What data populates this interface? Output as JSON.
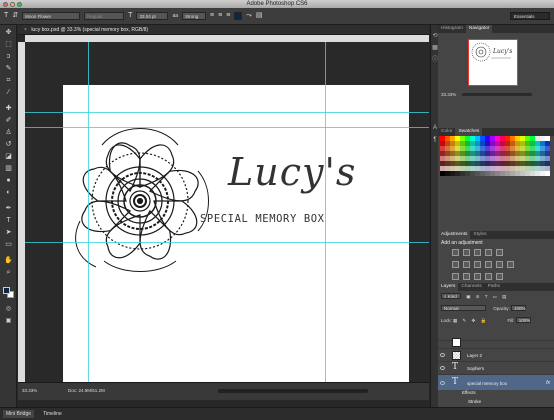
{
  "window": {
    "title": "Adobe Photoshop CS6",
    "traffic_colors": [
      "#fc605c",
      "#fdbc40",
      "#34c84a"
    ]
  },
  "options": {
    "tool_icon": "type-tool-icon",
    "orientation_icon": "text-orientation-icon",
    "font_family": "Moon Flower",
    "font_style": "Regular",
    "size_icon": "font-size-icon",
    "font_size": "33.04 pt",
    "aa_icon": "antialias-icon",
    "antialias": "Strong",
    "workspace": "Essentials"
  },
  "document": {
    "tab_label": "lucy box.psd @ 33.3% (special  memory  box, RGB/8)",
    "art_title": "Lucy's",
    "art_subtitle": "SPECIAL MEMORY BOX"
  },
  "status": {
    "zoom": "33.33%",
    "doc": "Doc: 24.9M/61.2M"
  },
  "bottom_tabs": [
    "Mini Bridge",
    "Timeline"
  ],
  "panels": {
    "navigator": {
      "tabs": [
        "Histogram",
        "Navigator"
      ],
      "zoom": "33.33%"
    },
    "swatches": {
      "tabs": [
        "Color",
        "Swatches"
      ]
    },
    "adjustments": {
      "tabs": [
        "Adjustments",
        "Styles"
      ],
      "title": "Add an adjustment"
    },
    "layers": {
      "tabs": [
        "Layers",
        "Channels",
        "Paths"
      ],
      "filter": "Kind",
      "blend_mode": "Normal",
      "opacity_label": "Opacity:",
      "opacity": "100%",
      "lock_label": "Lock:",
      "fill_label": "Fill:",
      "fill": "100%",
      "rows": [
        {
          "name": "Layer 2",
          "kind": "pixel"
        },
        {
          "name": "Sophie's",
          "kind": "text"
        },
        {
          "name": "special  memory  box",
          "kind": "text",
          "selected": true
        },
        {
          "name": "Effects",
          "kind": "sub"
        },
        {
          "name": "Stroke",
          "kind": "sub"
        }
      ]
    }
  },
  "tools": [
    "move-tool-icon",
    "marquee-tool-icon",
    "lasso-tool-icon",
    "quick-select-tool-icon",
    "crop-tool-icon",
    "eyedropper-tool-icon",
    "healing-brush-icon",
    "brush-tool-icon",
    "clone-stamp-icon",
    "history-brush-icon",
    "eraser-tool-icon",
    "gradient-tool-icon",
    "blur-tool-icon",
    "dodge-tool-icon",
    "pen-tool-icon",
    "type-tool-icon",
    "path-select-icon",
    "rectangle-tool-icon",
    "hand-tool-icon",
    "zoom-tool-icon"
  ],
  "colors": {
    "foreground": "#0d2740",
    "background": "#ffffff",
    "guide": "#38d2e0",
    "selected_layer": "#50678a"
  }
}
